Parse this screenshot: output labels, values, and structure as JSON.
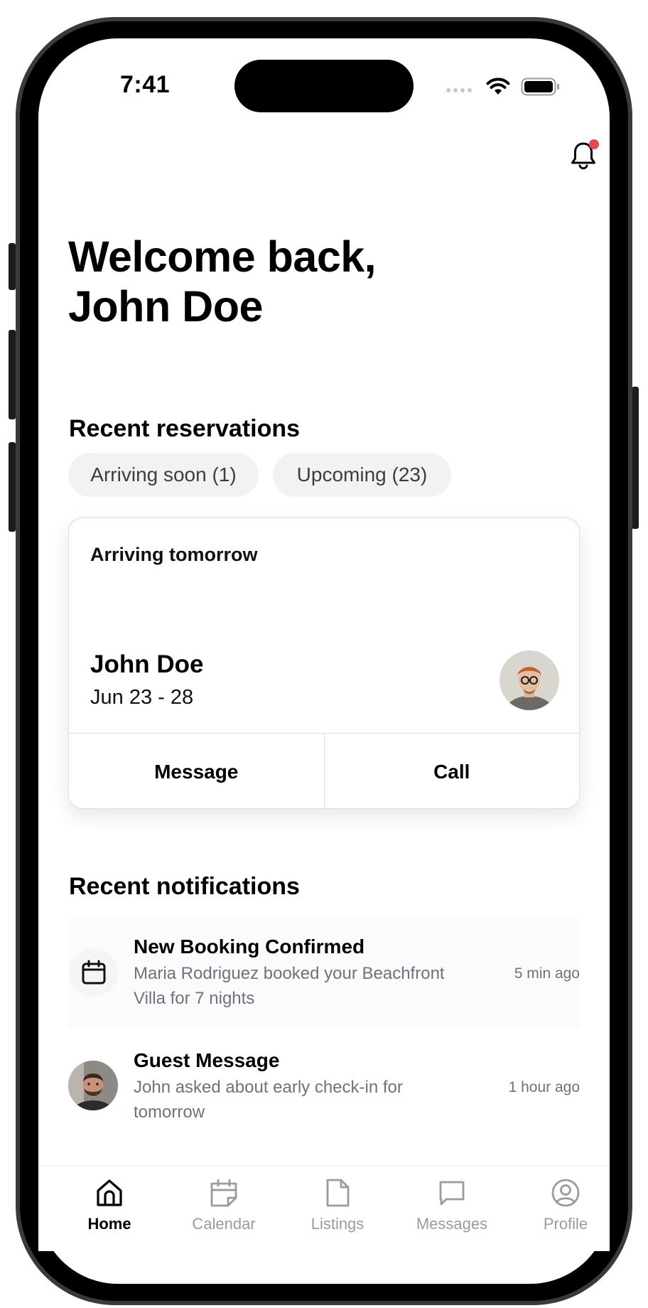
{
  "status_bar": {
    "time": "7:41"
  },
  "header": {
    "notifications_icon": "bell-icon",
    "has_unread": true
  },
  "welcome": {
    "line1": "Welcome back,",
    "line2": "John Doe"
  },
  "reservations": {
    "section_title": "Recent reservations",
    "filters": [
      {
        "label": "Arriving soon (1)"
      },
      {
        "label": "Upcoming (23)"
      }
    ],
    "card": {
      "label": "Arriving tomorrow",
      "guest_name": "John Doe",
      "dates": "Jun 23 - 28",
      "actions": {
        "message": "Message",
        "call": "Call"
      }
    }
  },
  "notifications": {
    "section_title": "Recent notifications",
    "items": [
      {
        "icon": "calendar-icon",
        "title": "New Booking Confirmed",
        "body": "Maria Rodriguez booked your Beachfront Villa for 7 nights",
        "time": "5 min ago"
      },
      {
        "icon": "avatar",
        "title": "Guest Message",
        "body": "John asked about early check-in for tomorrow",
        "time": "1 hour ago"
      }
    ]
  },
  "tab_bar": {
    "items": [
      {
        "label": "Home",
        "icon": "home-icon",
        "active": true
      },
      {
        "label": "Calendar",
        "icon": "calendar-icon",
        "active": false
      },
      {
        "label": "Listings",
        "icon": "document-icon",
        "active": false
      },
      {
        "label": "Messages",
        "icon": "chat-icon",
        "active": false
      },
      {
        "label": "Profile",
        "icon": "profile-icon",
        "active": false
      }
    ]
  },
  "colors": {
    "accent_dot": "#e5484d",
    "chip_bg": "#f2f2f2",
    "muted_text": "#6b7280",
    "inactive_tab": "#9a9a9f"
  }
}
